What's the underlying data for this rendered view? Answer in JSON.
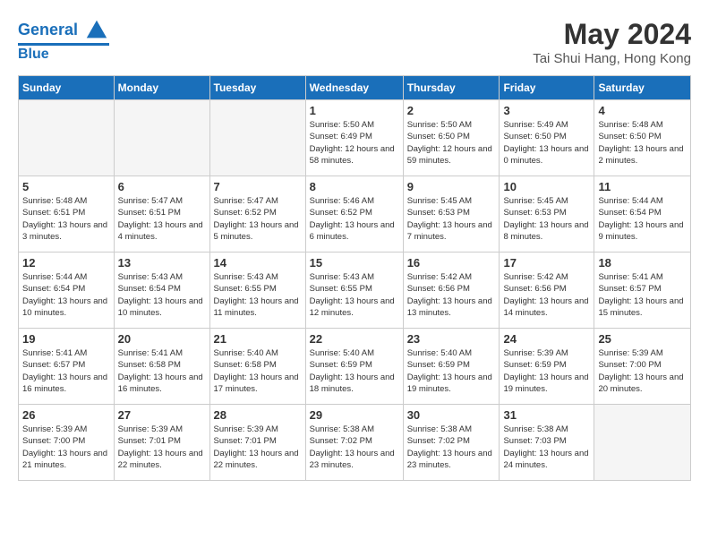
{
  "header": {
    "logo_line1": "General",
    "logo_line2": "Blue",
    "month": "May 2024",
    "location": "Tai Shui Hang, Hong Kong"
  },
  "days_of_week": [
    "Sunday",
    "Monday",
    "Tuesday",
    "Wednesday",
    "Thursday",
    "Friday",
    "Saturday"
  ],
  "weeks": [
    [
      {
        "day": "",
        "empty": true
      },
      {
        "day": "",
        "empty": true
      },
      {
        "day": "",
        "empty": true
      },
      {
        "day": "1",
        "sunrise": "5:50 AM",
        "sunset": "6:49 PM",
        "daylight": "12 hours and 58 minutes."
      },
      {
        "day": "2",
        "sunrise": "5:50 AM",
        "sunset": "6:50 PM",
        "daylight": "12 hours and 59 minutes."
      },
      {
        "day": "3",
        "sunrise": "5:49 AM",
        "sunset": "6:50 PM",
        "daylight": "13 hours and 0 minutes."
      },
      {
        "day": "4",
        "sunrise": "5:48 AM",
        "sunset": "6:50 PM",
        "daylight": "13 hours and 2 minutes."
      }
    ],
    [
      {
        "day": "5",
        "sunrise": "5:48 AM",
        "sunset": "6:51 PM",
        "daylight": "13 hours and 3 minutes."
      },
      {
        "day": "6",
        "sunrise": "5:47 AM",
        "sunset": "6:51 PM",
        "daylight": "13 hours and 4 minutes."
      },
      {
        "day": "7",
        "sunrise": "5:47 AM",
        "sunset": "6:52 PM",
        "daylight": "13 hours and 5 minutes."
      },
      {
        "day": "8",
        "sunrise": "5:46 AM",
        "sunset": "6:52 PM",
        "daylight": "13 hours and 6 minutes."
      },
      {
        "day": "9",
        "sunrise": "5:45 AM",
        "sunset": "6:53 PM",
        "daylight": "13 hours and 7 minutes."
      },
      {
        "day": "10",
        "sunrise": "5:45 AM",
        "sunset": "6:53 PM",
        "daylight": "13 hours and 8 minutes."
      },
      {
        "day": "11",
        "sunrise": "5:44 AM",
        "sunset": "6:54 PM",
        "daylight": "13 hours and 9 minutes."
      }
    ],
    [
      {
        "day": "12",
        "sunrise": "5:44 AM",
        "sunset": "6:54 PM",
        "daylight": "13 hours and 10 minutes."
      },
      {
        "day": "13",
        "sunrise": "5:43 AM",
        "sunset": "6:54 PM",
        "daylight": "13 hours and 10 minutes."
      },
      {
        "day": "14",
        "sunrise": "5:43 AM",
        "sunset": "6:55 PM",
        "daylight": "13 hours and 11 minutes."
      },
      {
        "day": "15",
        "sunrise": "5:43 AM",
        "sunset": "6:55 PM",
        "daylight": "13 hours and 12 minutes."
      },
      {
        "day": "16",
        "sunrise": "5:42 AM",
        "sunset": "6:56 PM",
        "daylight": "13 hours and 13 minutes."
      },
      {
        "day": "17",
        "sunrise": "5:42 AM",
        "sunset": "6:56 PM",
        "daylight": "13 hours and 14 minutes."
      },
      {
        "day": "18",
        "sunrise": "5:41 AM",
        "sunset": "6:57 PM",
        "daylight": "13 hours and 15 minutes."
      }
    ],
    [
      {
        "day": "19",
        "sunrise": "5:41 AM",
        "sunset": "6:57 PM",
        "daylight": "13 hours and 16 minutes."
      },
      {
        "day": "20",
        "sunrise": "5:41 AM",
        "sunset": "6:58 PM",
        "daylight": "13 hours and 16 minutes."
      },
      {
        "day": "21",
        "sunrise": "5:40 AM",
        "sunset": "6:58 PM",
        "daylight": "13 hours and 17 minutes."
      },
      {
        "day": "22",
        "sunrise": "5:40 AM",
        "sunset": "6:59 PM",
        "daylight": "13 hours and 18 minutes."
      },
      {
        "day": "23",
        "sunrise": "5:40 AM",
        "sunset": "6:59 PM",
        "daylight": "13 hours and 19 minutes."
      },
      {
        "day": "24",
        "sunrise": "5:39 AM",
        "sunset": "6:59 PM",
        "daylight": "13 hours and 19 minutes."
      },
      {
        "day": "25",
        "sunrise": "5:39 AM",
        "sunset": "7:00 PM",
        "daylight": "13 hours and 20 minutes."
      }
    ],
    [
      {
        "day": "26",
        "sunrise": "5:39 AM",
        "sunset": "7:00 PM",
        "daylight": "13 hours and 21 minutes."
      },
      {
        "day": "27",
        "sunrise": "5:39 AM",
        "sunset": "7:01 PM",
        "daylight": "13 hours and 22 minutes."
      },
      {
        "day": "28",
        "sunrise": "5:39 AM",
        "sunset": "7:01 PM",
        "daylight": "13 hours and 22 minutes."
      },
      {
        "day": "29",
        "sunrise": "5:38 AM",
        "sunset": "7:02 PM",
        "daylight": "13 hours and 23 minutes."
      },
      {
        "day": "30",
        "sunrise": "5:38 AM",
        "sunset": "7:02 PM",
        "daylight": "13 hours and 23 minutes."
      },
      {
        "day": "31",
        "sunrise": "5:38 AM",
        "sunset": "7:03 PM",
        "daylight": "13 hours and 24 minutes."
      },
      {
        "day": "",
        "empty": true
      }
    ]
  ]
}
